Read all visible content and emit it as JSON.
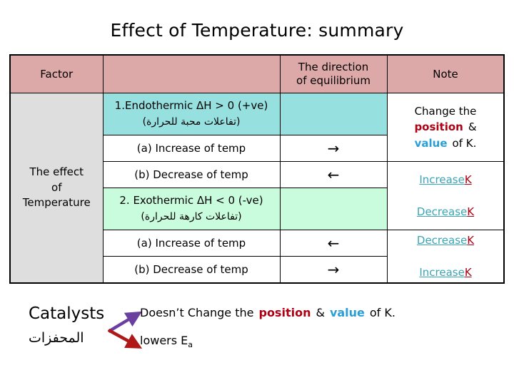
{
  "title": "Effect of Temperature: summary",
  "table": {
    "headers": {
      "factor": "Factor",
      "detail": "",
      "direction_line1": "The direction",
      "direction_line2": "of equilibrium",
      "note": "Note"
    },
    "factor_cell": {
      "line1": "The effect",
      "line2": "of",
      "line3": "Temperature"
    },
    "rows": [
      {
        "type": "section",
        "detail": "1.Endothermic ΔH > 0 (+ve)",
        "detail_arabic": "(تفاعلات محبة للحرارة)",
        "direction": "",
        "fill": "#97e0e0"
      },
      {
        "type": "item",
        "detail": "(a) Increase of temp",
        "direction": "→",
        "note_change": "Increase",
        "note_k": "K"
      },
      {
        "type": "item",
        "detail": "(b) Decrease of temp",
        "direction": "←",
        "note_change": "Decrease",
        "note_k": "K"
      },
      {
        "type": "section",
        "detail": "2. Exothermic ΔH < 0 (-ve)",
        "detail_arabic": "(تفاعلات كارهة للحرارة)",
        "direction": "",
        "fill": "#c9fbdd"
      },
      {
        "type": "item",
        "detail": "(a) Increase of temp",
        "direction": "←",
        "note_change": "Decrease",
        "note_k": "K"
      },
      {
        "type": "item",
        "detail": "(b) Decrease of temp",
        "direction": "→",
        "note_change": "Increase",
        "note_k": "K"
      }
    ],
    "note_top": {
      "line1": "Change the",
      "position": "position",
      "amp": "&",
      "value": "value",
      "of_k": "of  K."
    }
  },
  "catalysts": {
    "label": "Catalysts",
    "label_arabic": "المحفزات",
    "line1_pre": "Doesn’t Change the",
    "line1_position": "position",
    "line1_amp": "&",
    "line1_value": "value",
    "line1_post": "of  K.",
    "line2": "lowers E",
    "line2_sub": "a"
  },
  "colors": {
    "header_pink": "#dda8a8",
    "factor_gray": "#dedede",
    "endo_cyan": "#97e0e0",
    "exo_mint": "#c9fbdd",
    "position_red": "#b00014",
    "value_blue": "#2a9fd6",
    "change_teal": "#3aa5b5",
    "arrow_purple": "#6b3fa0",
    "arrow_red": "#b01818"
  }
}
